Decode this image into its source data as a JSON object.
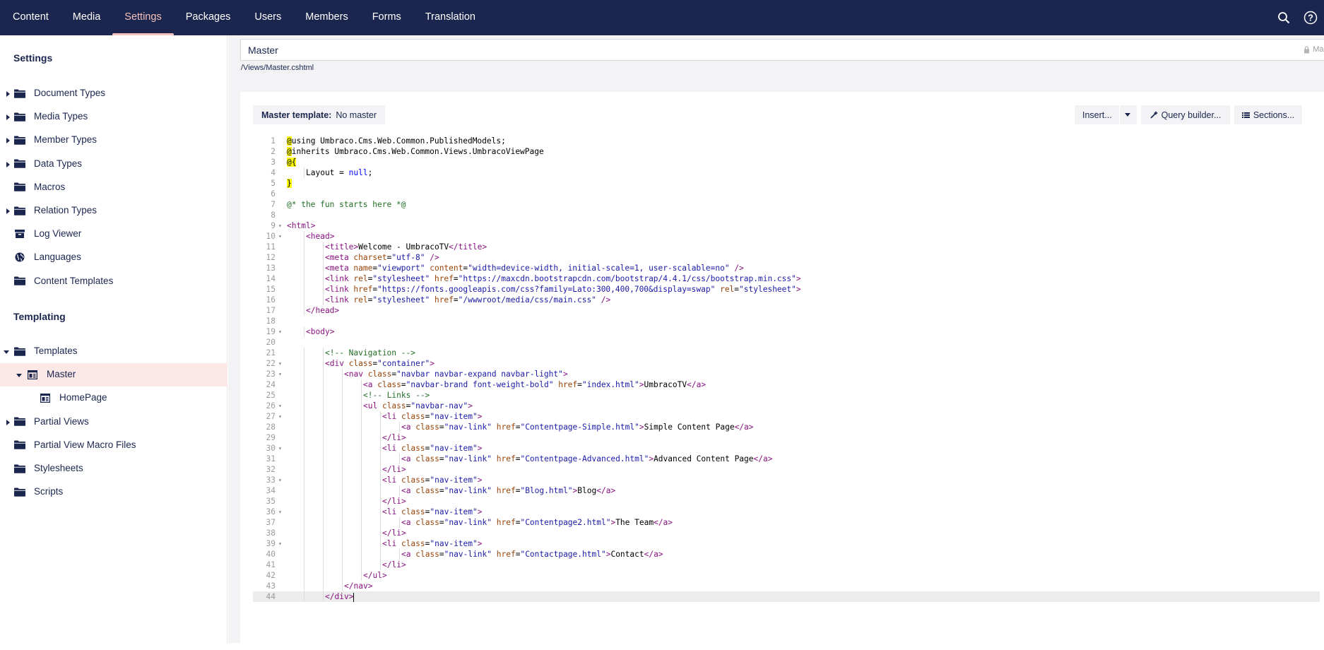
{
  "topnav": {
    "items": [
      {
        "label": "Content",
        "active": false
      },
      {
        "label": "Media",
        "active": false
      },
      {
        "label": "Settings",
        "active": true
      },
      {
        "label": "Packages",
        "active": false
      },
      {
        "label": "Users",
        "active": false
      },
      {
        "label": "Members",
        "active": false
      },
      {
        "label": "Forms",
        "active": false
      },
      {
        "label": "Translation",
        "active": false
      }
    ],
    "icons": [
      "search-icon",
      "help-icon"
    ]
  },
  "sidebar": {
    "settings_title": "Settings",
    "settings_items": [
      {
        "label": "Document Types",
        "icon": "folder-icon",
        "has_children": true
      },
      {
        "label": "Media Types",
        "icon": "folder-icon",
        "has_children": true
      },
      {
        "label": "Member Types",
        "icon": "folder-icon",
        "has_children": true
      },
      {
        "label": "Data Types",
        "icon": "folder-icon",
        "has_children": true
      },
      {
        "label": "Macros",
        "icon": "folder-icon",
        "has_children": false
      },
      {
        "label": "Relation Types",
        "icon": "folder-icon",
        "has_children": true
      },
      {
        "label": "Log Viewer",
        "icon": "box-icon",
        "has_children": false
      },
      {
        "label": "Languages",
        "icon": "globe-icon",
        "has_children": false
      },
      {
        "label": "Content Templates",
        "icon": "folder-icon",
        "has_children": false
      }
    ],
    "templating_title": "Templating",
    "templating_items": [
      {
        "label": "Templates",
        "icon": "folder-icon",
        "expanded": true
      },
      {
        "label": "Master",
        "icon": "template-icon",
        "expanded": true,
        "selected": true
      },
      {
        "label": "HomePage",
        "icon": "template-icon"
      },
      {
        "label": "Partial Views",
        "icon": "folder-icon",
        "has_children": true
      },
      {
        "label": "Partial View Macro Files",
        "icon": "folder-icon"
      },
      {
        "label": "Stylesheets",
        "icon": "folder-icon"
      },
      {
        "label": "Scripts",
        "icon": "folder-icon"
      }
    ]
  },
  "editor": {
    "name": "Master",
    "alias_partial": "Mas",
    "path": "/Views/Master.cshtml",
    "master_template_label": "Master template:",
    "master_template_value": "No master",
    "insert_label": "Insert...",
    "query_builder_label": "Query builder...",
    "sections_label": "Sections..."
  },
  "code": {
    "current_line": 44,
    "lines": [
      {
        "n": 1,
        "indent": 0,
        "text": "@using Umbraco.Cms.Web.Common.PublishedModels;"
      },
      {
        "n": 2,
        "indent": 0,
        "text": "@inherits Umbraco.Cms.Web.Common.Views.UmbracoViewPage"
      },
      {
        "n": 3,
        "indent": 0,
        "text": "@{"
      },
      {
        "n": 4,
        "indent": 1,
        "text": "Layout = null;"
      },
      {
        "n": 5,
        "indent": 0,
        "text": "}"
      },
      {
        "n": 6,
        "indent": 0,
        "text": ""
      },
      {
        "n": 7,
        "indent": 0,
        "text": "@* the fun starts here *@"
      },
      {
        "n": 8,
        "indent": 0,
        "text": ""
      },
      {
        "n": 9,
        "indent": 0,
        "fold": true,
        "text": "<html>"
      },
      {
        "n": 10,
        "indent": 1,
        "fold": true,
        "text": "<head>"
      },
      {
        "n": 11,
        "indent": 2,
        "text": "<title>Welcome - UmbracoTV</title>"
      },
      {
        "n": 12,
        "indent": 2,
        "text": "<meta charset=\"utf-8\" />"
      },
      {
        "n": 13,
        "indent": 2,
        "text": "<meta name=\"viewport\" content=\"width=device-width, initial-scale=1, user-scalable=no\" />"
      },
      {
        "n": 14,
        "indent": 2,
        "text": "<link rel=\"stylesheet\" href=\"https://maxcdn.bootstrapcdn.com/bootstrap/4.4.1/css/bootstrap.min.css\">"
      },
      {
        "n": 15,
        "indent": 2,
        "text": "<link href=\"https://fonts.googleapis.com/css?family=Lato:300,400,700&display=swap\" rel=\"stylesheet\">"
      },
      {
        "n": 16,
        "indent": 2,
        "text": "<link rel=\"stylesheet\" href=\"/wwwroot/media/css/main.css\" />"
      },
      {
        "n": 17,
        "indent": 1,
        "text": "</head>"
      },
      {
        "n": 18,
        "indent": 0,
        "text": ""
      },
      {
        "n": 19,
        "indent": 1,
        "fold": true,
        "text": "<body>"
      },
      {
        "n": 20,
        "indent": 0,
        "text": ""
      },
      {
        "n": 21,
        "indent": 2,
        "text": "<!-- Navigation -->"
      },
      {
        "n": 22,
        "indent": 2,
        "fold": true,
        "text": "<div class=\"container\">"
      },
      {
        "n": 23,
        "indent": 3,
        "fold": true,
        "text": "<nav class=\"navbar navbar-expand navbar-light\">"
      },
      {
        "n": 24,
        "indent": 4,
        "text": "<a class=\"navbar-brand font-weight-bold\" href=\"index.html\">UmbracoTV</a>"
      },
      {
        "n": 25,
        "indent": 4,
        "text": "<!-- Links -->"
      },
      {
        "n": 26,
        "indent": 4,
        "fold": true,
        "text": "<ul class=\"navbar-nav\">"
      },
      {
        "n": 27,
        "indent": 5,
        "fold": true,
        "text": "<li class=\"nav-item\">"
      },
      {
        "n": 28,
        "indent": 6,
        "text": "<a class=\"nav-link\" href=\"Contentpage-Simple.html\">Simple Content Page</a>"
      },
      {
        "n": 29,
        "indent": 5,
        "text": "</li>"
      },
      {
        "n": 30,
        "indent": 5,
        "fold": true,
        "text": "<li class=\"nav-item\">"
      },
      {
        "n": 31,
        "indent": 6,
        "text": "<a class=\"nav-link\" href=\"Contentpage-Advanced.html\">Advanced Content Page</a>"
      },
      {
        "n": 32,
        "indent": 5,
        "text": "</li>"
      },
      {
        "n": 33,
        "indent": 5,
        "fold": true,
        "text": "<li class=\"nav-item\">"
      },
      {
        "n": 34,
        "indent": 6,
        "text": "<a class=\"nav-link\" href=\"Blog.html\">Blog</a>"
      },
      {
        "n": 35,
        "indent": 5,
        "text": "</li>"
      },
      {
        "n": 36,
        "indent": 5,
        "fold": true,
        "text": "<li class=\"nav-item\">"
      },
      {
        "n": 37,
        "indent": 6,
        "text": "<a class=\"nav-link\" href=\"Contentpage2.html\">The Team</a>"
      },
      {
        "n": 38,
        "indent": 5,
        "text": "</li>"
      },
      {
        "n": 39,
        "indent": 5,
        "fold": true,
        "text": "<li class=\"nav-item\">"
      },
      {
        "n": 40,
        "indent": 6,
        "text": "<a class=\"nav-link\" href=\"Contactpage.html\">Contact</a>"
      },
      {
        "n": 41,
        "indent": 5,
        "text": "</li>"
      },
      {
        "n": 42,
        "indent": 4,
        "text": "</ul>"
      },
      {
        "n": 43,
        "indent": 3,
        "text": "</nav>"
      },
      {
        "n": 44,
        "indent": 2,
        "text": "</div>"
      }
    ]
  },
  "colors": {
    "topbar": "#1b264f",
    "active_tab": "#f5c1bc",
    "selected_row": "#fce8e6",
    "tag": "#881280",
    "attr": "#994409",
    "value": "#1a1aa6",
    "comment": "#236e25",
    "keyword": "#0000ff"
  }
}
